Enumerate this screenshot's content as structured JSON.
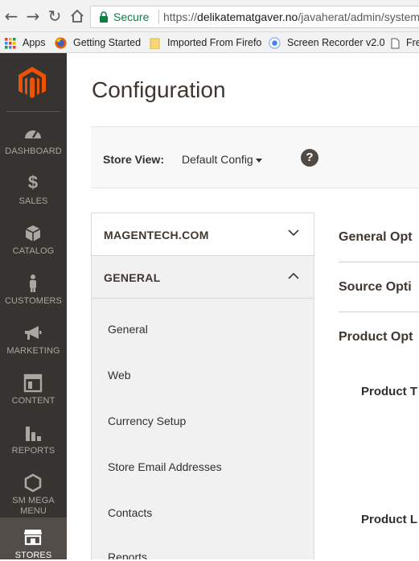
{
  "browser": {
    "secure_label": "Secure",
    "url_scheme": "https://",
    "url_host": "delikatematgaver.no",
    "url_path": "/javaherat/admin/system",
    "bookmarks": [
      {
        "label": "Apps",
        "icon": "apps-grid-icon"
      },
      {
        "label": "Getting Started",
        "icon": "firefox-icon"
      },
      {
        "label": "Imported From Firefo",
        "icon": "folder-icon"
      },
      {
        "label": "Screen Recorder v2.0",
        "icon": "screen-recorder-icon"
      },
      {
        "label": "Fre",
        "icon": "page-icon"
      }
    ]
  },
  "sidebar": {
    "items": [
      {
        "label": "DASHBOARD",
        "icon": "dashboard-gauge-icon"
      },
      {
        "label": "SALES",
        "icon": "dollar-icon"
      },
      {
        "label": "CATALOG",
        "icon": "box-icon"
      },
      {
        "label": "CUSTOMERS",
        "icon": "person-icon"
      },
      {
        "label": "MARKETING",
        "icon": "megaphone-icon"
      },
      {
        "label": "CONTENT",
        "icon": "layout-icon"
      },
      {
        "label": "REPORTS",
        "icon": "bar-chart-icon"
      },
      {
        "label": "SM MEGA",
        "label2": "MENU",
        "icon": "hexagon-icon"
      },
      {
        "label": "STORES",
        "icon": "store-icon"
      }
    ]
  },
  "page": {
    "title": "Configuration",
    "scope_label": "Store View:",
    "scope_value": "Default Config",
    "help": "?"
  },
  "tabs": {
    "groups": [
      {
        "label": "MAGENTECH.COM",
        "state": "collapsed"
      },
      {
        "label": "GENERAL",
        "state": "expanded"
      }
    ],
    "general_items": [
      "General",
      "Web",
      "Currency Setup",
      "Store Email Addresses",
      "Contacts",
      "Reports"
    ]
  },
  "content": {
    "sections": [
      "General Opt",
      "Source Opti",
      "Product Opt"
    ],
    "fields": [
      "Product T",
      "Product L"
    ]
  },
  "colors": {
    "sidebar_bg": "#373330",
    "sidebar_active": "#524d49",
    "logo": "#eb5202",
    "secure_green": "#0b8043"
  }
}
